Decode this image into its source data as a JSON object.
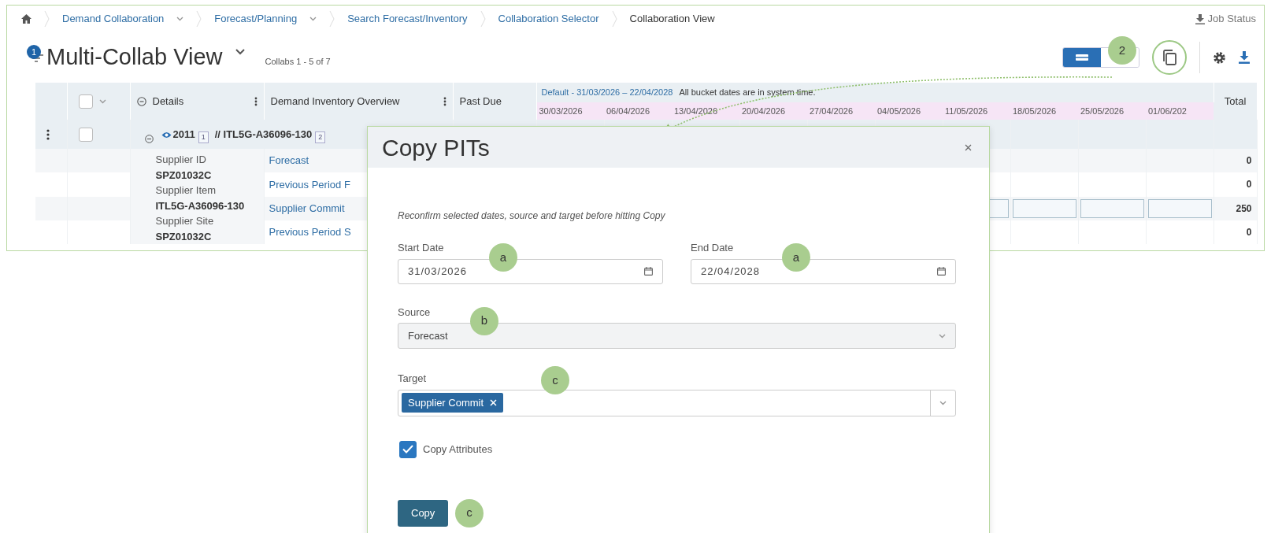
{
  "breadcrumb": [
    {
      "label": "Demand Collaboration",
      "dropdown": true,
      "current": false
    },
    {
      "label": "Forecast/Planning",
      "dropdown": true,
      "current": false
    },
    {
      "label": "Search Forecast/Inventory",
      "dropdown": false,
      "current": false
    },
    {
      "label": "Collaboration Selector",
      "dropdown": false,
      "current": false
    },
    {
      "label": "Collaboration View",
      "dropdown": false,
      "current": true
    }
  ],
  "job_status": "Job Status",
  "header": {
    "filter_count": "1",
    "title": "Multi-Collab View",
    "range": "Collabs 1 - 5 of 7",
    "callout": "2"
  },
  "view_toggle": [
    {
      "selected": true
    },
    {
      "selected": false
    }
  ],
  "table": {
    "select_all": {
      "checked": false
    },
    "columns": [
      "Details",
      "Demand Inventory Overview",
      "Past Due"
    ],
    "bucket_range": "Default - 31/03/2026 – 22/04/2028",
    "bucket_note": "All bucket dates are in system time.",
    "dates": [
      "30/03/2026",
      "06/04/2026",
      "13/04/2026",
      "20/04/2026",
      "27/04/2026",
      "04/05/2026",
      "11/05/2026",
      "18/05/2026",
      "25/05/2026",
      "01/06/202"
    ],
    "total_label": "Total",
    "group": {
      "checked": false,
      "expanded": true,
      "id": "2011",
      "id_index": "1",
      "item": "// ITL5G-A36096-130",
      "item_index": "2"
    },
    "details": [
      {
        "label": "Supplier ID",
        "value": "SPZ01032C"
      },
      {
        "label": "Supplier Item",
        "value": "ITL5G-A36096-130"
      },
      {
        "label": "Supplier Site",
        "value": "SPZ01032C"
      }
    ],
    "rows": [
      {
        "measure": "Forecast",
        "total": "0",
        "editable": false
      },
      {
        "measure": "Previous Period F",
        "total": "0",
        "editable": false
      },
      {
        "measure": "Supplier Commit",
        "total": "250",
        "editable": true
      },
      {
        "measure": "Previous Period S",
        "total": "0",
        "editable": false
      }
    ]
  },
  "dialog": {
    "title": "Copy PITs",
    "note": "Reconfirm selected dates, source and target before hitting Copy",
    "start_date": {
      "label": "Start Date",
      "value": "31/03/2026",
      "callout": "a"
    },
    "end_date": {
      "label": "End Date",
      "value": "22/04/2028",
      "callout": "a"
    },
    "source": {
      "label": "Source",
      "value": "Forecast",
      "callout": "b"
    },
    "target": {
      "label": "Target",
      "chips": [
        "Supplier Commit"
      ],
      "callout": "c"
    },
    "copy_attributes": {
      "label": "Copy Attributes",
      "checked": true
    },
    "button": {
      "label": "Copy",
      "callout": "c"
    }
  }
}
